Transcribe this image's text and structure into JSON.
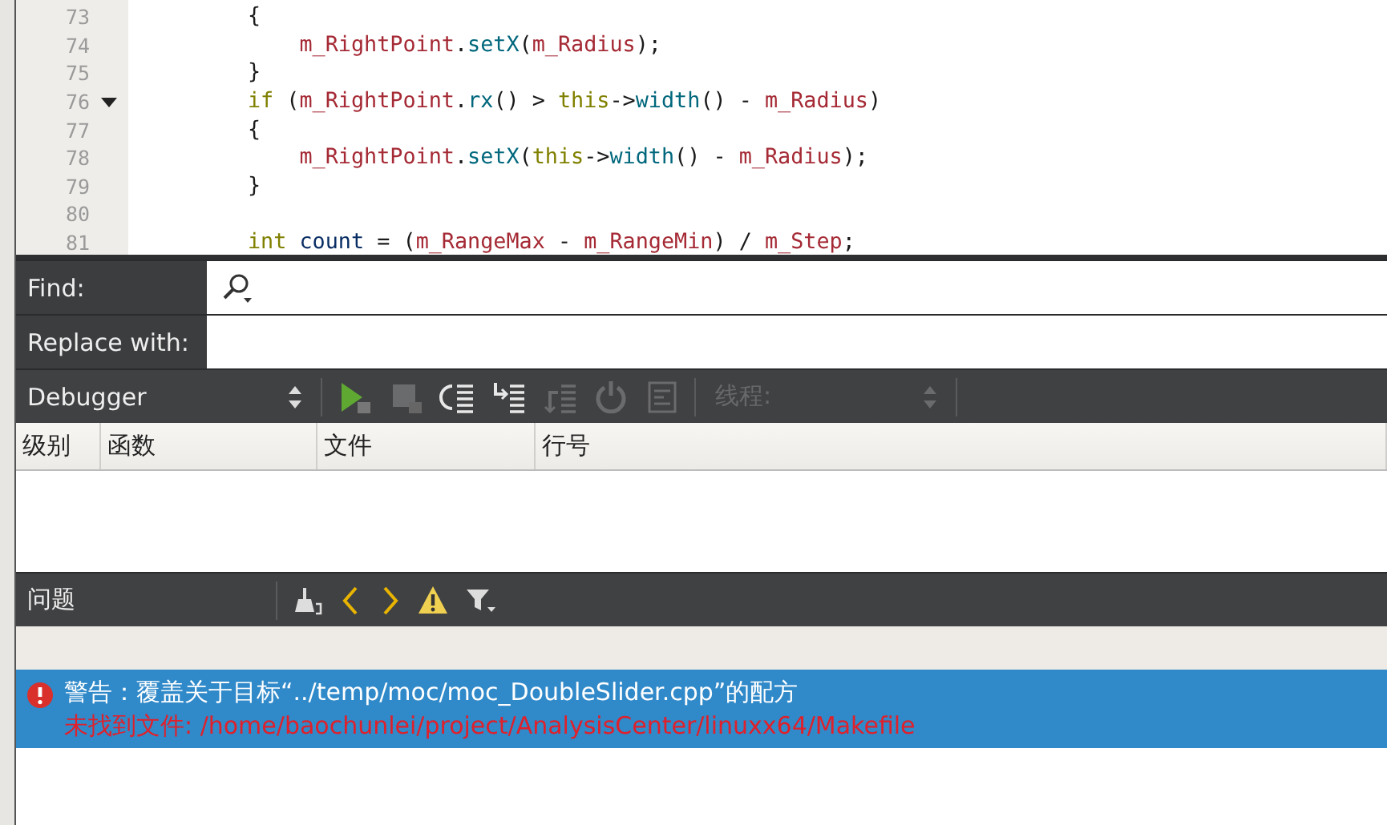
{
  "editor": {
    "lines": [
      {
        "number": "73",
        "fold": false,
        "tokens": [
          {
            "kind": "plain",
            "text": "        {"
          }
        ]
      },
      {
        "number": "74",
        "fold": false,
        "tokens": [
          {
            "kind": "member",
            "text": "            m_RightPoint"
          },
          {
            "kind": "plain",
            "text": "."
          },
          {
            "kind": "method",
            "text": "setX"
          },
          {
            "kind": "plain",
            "text": "("
          },
          {
            "kind": "member",
            "text": "m_Radius"
          },
          {
            "kind": "plain",
            "text": ");"
          }
        ]
      },
      {
        "number": "75",
        "fold": false,
        "tokens": [
          {
            "kind": "plain",
            "text": "        }"
          }
        ]
      },
      {
        "number": "76",
        "fold": true,
        "tokens": [
          {
            "kind": "keyword",
            "text": "        if"
          },
          {
            "kind": "plain",
            "text": " ("
          },
          {
            "kind": "member",
            "text": "m_RightPoint"
          },
          {
            "kind": "plain",
            "text": "."
          },
          {
            "kind": "method",
            "text": "rx"
          },
          {
            "kind": "plain",
            "text": "() > "
          },
          {
            "kind": "keyword",
            "text": "this"
          },
          {
            "kind": "plain",
            "text": "->"
          },
          {
            "kind": "method",
            "text": "width"
          },
          {
            "kind": "plain",
            "text": "() - "
          },
          {
            "kind": "member",
            "text": "m_Radius"
          },
          {
            "kind": "plain",
            "text": ")"
          }
        ]
      },
      {
        "number": "77",
        "fold": false,
        "tokens": [
          {
            "kind": "plain",
            "text": "        {"
          }
        ]
      },
      {
        "number": "78",
        "fold": false,
        "tokens": [
          {
            "kind": "member",
            "text": "            m_RightPoint"
          },
          {
            "kind": "plain",
            "text": "."
          },
          {
            "kind": "method",
            "text": "setX"
          },
          {
            "kind": "plain",
            "text": "("
          },
          {
            "kind": "keyword",
            "text": "this"
          },
          {
            "kind": "plain",
            "text": "->"
          },
          {
            "kind": "method",
            "text": "width"
          },
          {
            "kind": "plain",
            "text": "() - "
          },
          {
            "kind": "member",
            "text": "m_Radius"
          },
          {
            "kind": "plain",
            "text": ");"
          }
        ]
      },
      {
        "number": "79",
        "fold": false,
        "tokens": [
          {
            "kind": "plain",
            "text": "        }"
          }
        ]
      },
      {
        "number": "80",
        "fold": false
      },
      {
        "number": "81",
        "fold": false,
        "tokens": [
          {
            "kind": "keyword",
            "text": "        int"
          },
          {
            "kind": "local",
            "text": " count"
          },
          {
            "kind": "plain",
            "text": " = ("
          },
          {
            "kind": "member",
            "text": "m_RangeMax"
          },
          {
            "kind": "plain",
            "text": " - "
          },
          {
            "kind": "member",
            "text": "m_RangeMin"
          },
          {
            "kind": "plain",
            "text": ") / "
          },
          {
            "kind": "member",
            "text": "m_Step"
          },
          {
            "kind": "plain",
            "text": ";"
          }
        ]
      }
    ]
  },
  "find": {
    "find_label": "Find:",
    "replace_label": "Replace with:"
  },
  "debugger": {
    "engine": "Debugger",
    "buttons": [
      {
        "kind": "continue",
        "disabled": false
      },
      {
        "kind": "stop",
        "disabled": true
      },
      {
        "kind": "step-over",
        "disabled": false
      },
      {
        "kind": "step-into",
        "disabled": false
      },
      {
        "kind": "step-out",
        "disabled": true
      },
      {
        "kind": "restart",
        "disabled": true
      },
      {
        "kind": "log",
        "disabled": true
      }
    ],
    "thread": {
      "label": "线程:",
      "disabled": true
    },
    "columns": [
      "级别",
      "函数",
      "文件",
      "行号"
    ]
  },
  "issues": {
    "title": "问题",
    "items": [
      {
        "kind": "error",
        "selected": true,
        "message": "警告：覆盖关于目标“../temp/moc/moc_DoubleSlider.cpp”的配方",
        "detail": "未找到文件: /home/baochunlei/project/AnalysisCenter/linuxx64/Makefile"
      }
    ]
  }
}
